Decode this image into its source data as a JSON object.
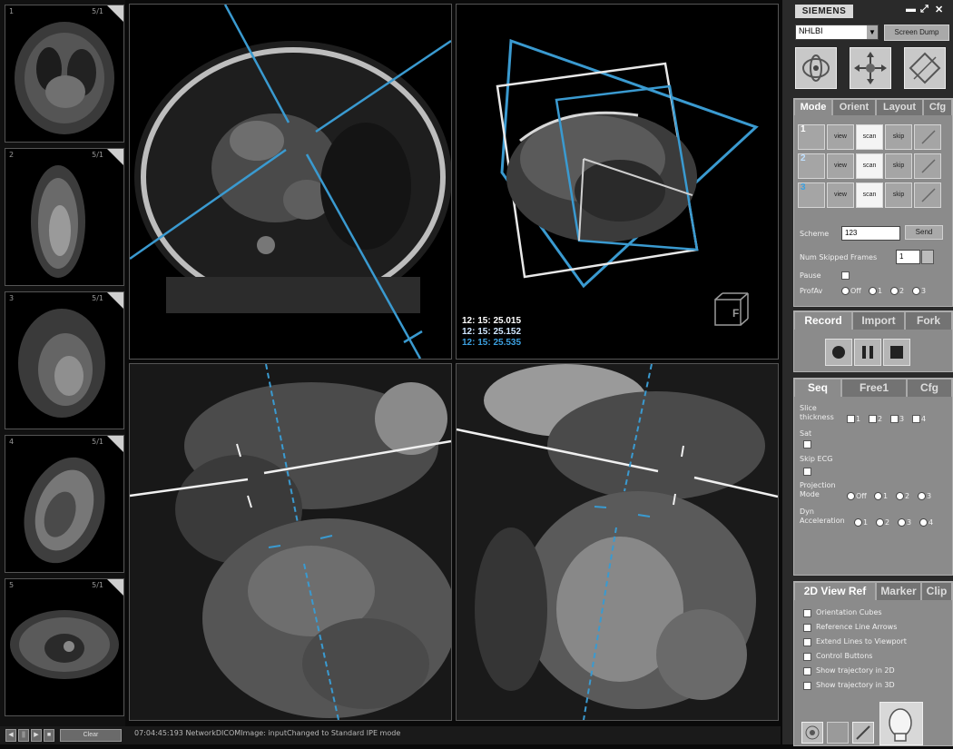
{
  "thumbnails": [
    {
      "num": "1",
      "frames": "5/1"
    },
    {
      "num": "2",
      "frames": "5/1"
    },
    {
      "num": "3",
      "frames": "5/1"
    },
    {
      "num": "4",
      "frames": "5/1"
    },
    {
      "num": "5",
      "frames": "5/1"
    }
  ],
  "viewport3d": {
    "timestamps": [
      {
        "text": "12: 15: 25.015",
        "color": "#ffffff"
      },
      {
        "text": "12: 15: 25.152",
        "color": "#cfe6ff"
      },
      {
        "text": "12: 15: 25.535",
        "color": "#3ca0e0"
      }
    ],
    "orientation_cube_label": "F"
  },
  "statusbar": {
    "buttons": [
      "◀",
      "||",
      "▶",
      "■"
    ],
    "clear_label": "Clear",
    "message": "07:04:45:193  NetworkDICOMImage: inputChanged to Standard IPE mode"
  },
  "panel": {
    "logo": "SIEMENS",
    "window_controls": [
      "▬",
      "⤢",
      "✕"
    ],
    "site_select": "NHLBI",
    "screen_dump_label": "Screen Dump",
    "tool_icons": [
      "rotate-icon",
      "pan-icon",
      "plane-icon"
    ],
    "mode_tabs": [
      "Mode",
      "Orient",
      "Layout",
      "Cfg"
    ],
    "slice_rows": [
      {
        "index": "1",
        "color": "#ffffff",
        "cells": [
          "view",
          "scan",
          "skip",
          ""
        ]
      },
      {
        "index": "2",
        "color": "#bfe0ff",
        "cells": [
          "view",
          "scan",
          "skip",
          ""
        ]
      },
      {
        "index": "3",
        "color": "#3ca0e0",
        "cells": [
          "view",
          "scan",
          "skip",
          ""
        ]
      }
    ],
    "scheme_label": "Scheme",
    "scheme_value": "123",
    "send_label": "Send",
    "num_skipped_label": "Num Skipped Frames",
    "num_skipped_value": "1",
    "pause_label": "Pause",
    "profilav_label": "ProfAv",
    "profilav_options": [
      "Off",
      "1",
      "2",
      "3"
    ],
    "record_tabs": [
      "Record",
      "Import",
      "Fork"
    ],
    "seq_tabs": [
      "Seq",
      "Free1",
      "Cfg"
    ],
    "slice_thickness_label": "Slice\nthickness",
    "slice_thickness_options": [
      "1",
      "2",
      "3",
      "4"
    ],
    "sat_label": "Sat",
    "skip_ecg_label": "Skip ECG",
    "projection_label": "Projection\nMode",
    "projection_options": [
      "Off",
      "1",
      "2",
      "3"
    ],
    "dyn_label": "Dyn\nAcceleration",
    "dyn_options": [
      "1",
      "2",
      "3",
      "4"
    ],
    "view_tabs": [
      "2D View Ref",
      "Marker",
      "Clip"
    ],
    "view_options": [
      "Orientation Cubes",
      "Reference Line Arrows",
      "Extend Lines to Viewport",
      "Control Buttons",
      "Show trajectory in 2D",
      "Show trajectory in 3D"
    ],
    "accent_blue": "#3a9ad0"
  }
}
